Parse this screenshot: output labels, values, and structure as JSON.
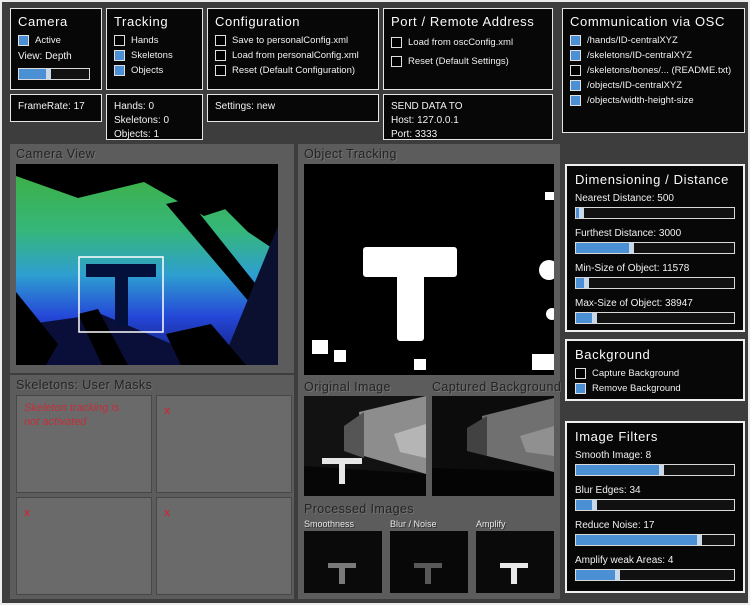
{
  "colors": {
    "accent_blue": "#4b8fd5",
    "alert_red": "#c0303a"
  },
  "panels": {
    "camera": {
      "title": "Camera",
      "active": {
        "label": "Active",
        "checked": true
      },
      "view_label": "View:",
      "view_value": "Depth",
      "view_slider_pct": 45
    },
    "tracking": {
      "title": "Tracking",
      "items": [
        {
          "label": "Hands",
          "checked": false
        },
        {
          "label": "Skeletons",
          "checked": true
        },
        {
          "label": "Objects",
          "checked": true
        }
      ]
    },
    "configuration": {
      "title": "Configuration",
      "items": [
        {
          "label": "Save to personalConfig.xml",
          "checked": false
        },
        {
          "label": "Load from personalConfig.xml",
          "checked": false
        },
        {
          "label": "Reset (Default Configuration)",
          "checked": false
        }
      ]
    },
    "port": {
      "title": "Port / Remote Address",
      "items": [
        {
          "label": "Load from oscConfig.xml",
          "checked": false
        },
        {
          "label": "Reset (Default Settings)",
          "checked": false
        }
      ]
    },
    "osc": {
      "title": "Communication via OSC",
      "items": [
        {
          "label": "/hands/ID-centralXYZ",
          "checked": true
        },
        {
          "label": "/skeletons/ID-centralXYZ",
          "checked": true
        },
        {
          "label": "/skeletons/bones/... (README.txt)",
          "checked": false
        },
        {
          "label": "/objects/ID-centralXYZ",
          "checked": true
        },
        {
          "label": "/objects/width-height-size",
          "checked": true
        }
      ]
    }
  },
  "status": {
    "framerate": "FrameRate: 17",
    "hands": "Hands: 0",
    "skeletons": "Skeletons: 0",
    "objects": "Objects: 1",
    "settings": "Settings: new",
    "send_title": "SEND DATA TO",
    "host": "Host: 127.0.0.1",
    "port": "Port: 3333"
  },
  "camera_view": {
    "title": "Camera View"
  },
  "skeletons_panel": {
    "title": "Skeletons: User Masks",
    "message_line1": "Skeleton tracking is",
    "message_line2": "not activated",
    "mask_mark": "x"
  },
  "object_tracking": {
    "title": "Object Tracking",
    "original_label": "Original Image",
    "background_label": "Captured Background",
    "processed_label": "Processed Images",
    "processed_items": [
      "Smoothness",
      "Blur / Noise",
      "Amplify"
    ]
  },
  "dimensioning": {
    "title": "Dimensioning / Distance",
    "sliders": [
      {
        "label": "Nearest Distance: 500",
        "pct": 5
      },
      {
        "label": "Furthest Distance: 3000",
        "pct": 37
      },
      {
        "label": "Min-Size of Object: 11578",
        "pct": 8
      },
      {
        "label": "Max-Size of Object: 38947",
        "pct": 13
      }
    ]
  },
  "background_panel": {
    "title": "Background",
    "items": [
      {
        "label": "Capture Background",
        "checked": false
      },
      {
        "label": "Remove Background",
        "checked": true
      }
    ]
  },
  "image_filters": {
    "title": "Image Filters",
    "sliders": [
      {
        "label": "Smooth Image: 8",
        "pct": 56
      },
      {
        "label": "Blur Edges: 34",
        "pct": 13
      },
      {
        "label": "Reduce Noise: 17",
        "pct": 80
      },
      {
        "label": "Amplify weak Areas: 4",
        "pct": 28
      }
    ]
  }
}
